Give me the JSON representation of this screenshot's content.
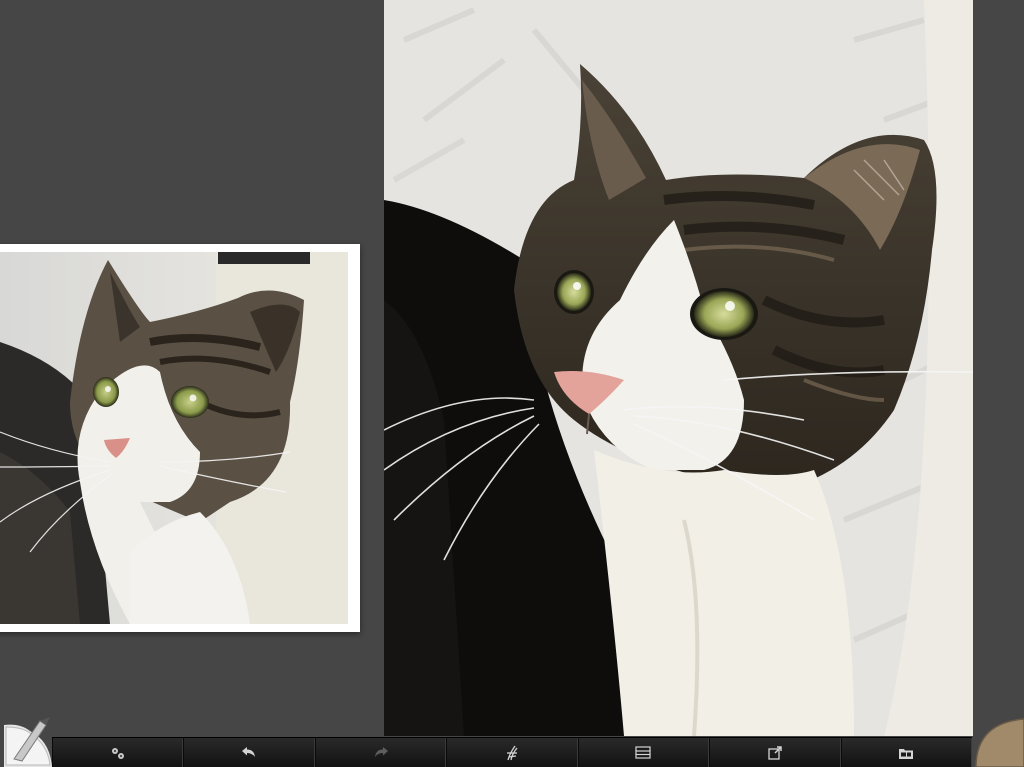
{
  "app": {
    "name": "painting-app"
  },
  "colors": {
    "background": "#464646",
    "toolbar": "#1a1a1a",
    "current_color": "#a08a6a",
    "canvas_background": "#e8e6e2"
  },
  "toolbar": {
    "buttons": [
      {
        "id": "settings",
        "icon": "gear-icon",
        "enabled": true
      },
      {
        "id": "undo",
        "icon": "undo-arrow-icon",
        "enabled": true
      },
      {
        "id": "redo",
        "icon": "redo-arrow-icon",
        "enabled": false
      },
      {
        "id": "brush-presets",
        "icon": "brush-strokes-icon",
        "enabled": true
      },
      {
        "id": "layers",
        "icon": "layers-icon",
        "enabled": true
      },
      {
        "id": "share",
        "icon": "share-export-icon",
        "enabled": true
      },
      {
        "id": "gallery",
        "icon": "gallery-folder-icon",
        "enabled": true
      }
    ]
  },
  "reference": {
    "icon": "reference-photo-cat"
  },
  "canvas": {
    "icon": "cat-painting"
  },
  "corners": {
    "brush": "brush-palette-knife-icon",
    "color": "color-swatch-icon"
  }
}
